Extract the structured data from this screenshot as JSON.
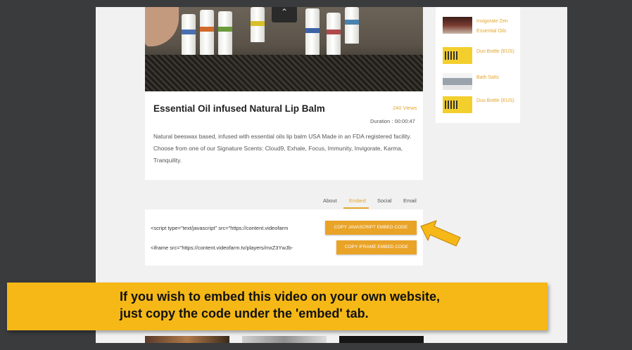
{
  "video": {
    "title": "Essential Oil infused Natural Lip Balm",
    "views": "240 Views",
    "duration_label": "Duration",
    "duration_value": "00:00:47",
    "description": "Natural beeswax based, infused with essential oils lip balm USA Made in an FDA registered facility. Choose from one of our Signature Scents: Cloud9, Exhale, Focus, Immunity, Invigorate, Karma, Tranquility.",
    "play_icon": "chevron-up-icon"
  },
  "tabs": [
    {
      "label": "About",
      "active": false
    },
    {
      "label": "Embed",
      "active": true
    },
    {
      "label": "Social",
      "active": false
    },
    {
      "label": "Email",
      "active": false
    }
  ],
  "embed": {
    "script_code": "<script type=\"text/javascript\" src=\"https://content.videofarm",
    "iframe_code": "<iframe src=\"https://content.videofarm.tv/players/mxZ3YwJb-",
    "copy_js_label": "COPY JAVASCRIPT EMBED CODE",
    "copy_iframe_label": "COPY IFRAME EMBED CODE"
  },
  "sidebar": {
    "items": [
      {
        "label": "Invigorate Zen Essential Oils",
        "thumb": "red"
      },
      {
        "label": "Duo Bottle (EUS)",
        "thumb": "yellow"
      },
      {
        "label": "Bath Salts",
        "thumb": "bath"
      },
      {
        "label": "Duo Bottle (EUS)",
        "thumb": "yellow"
      }
    ]
  },
  "banner": {
    "line1": "If you wish to embed this video on your own website,",
    "line2": "just copy the code under the 'embed' tab."
  },
  "colors": {
    "accent": "#e4a62b",
    "button": "#e9a327",
    "banner": "#f5b817",
    "background": "#3a3b3d"
  }
}
